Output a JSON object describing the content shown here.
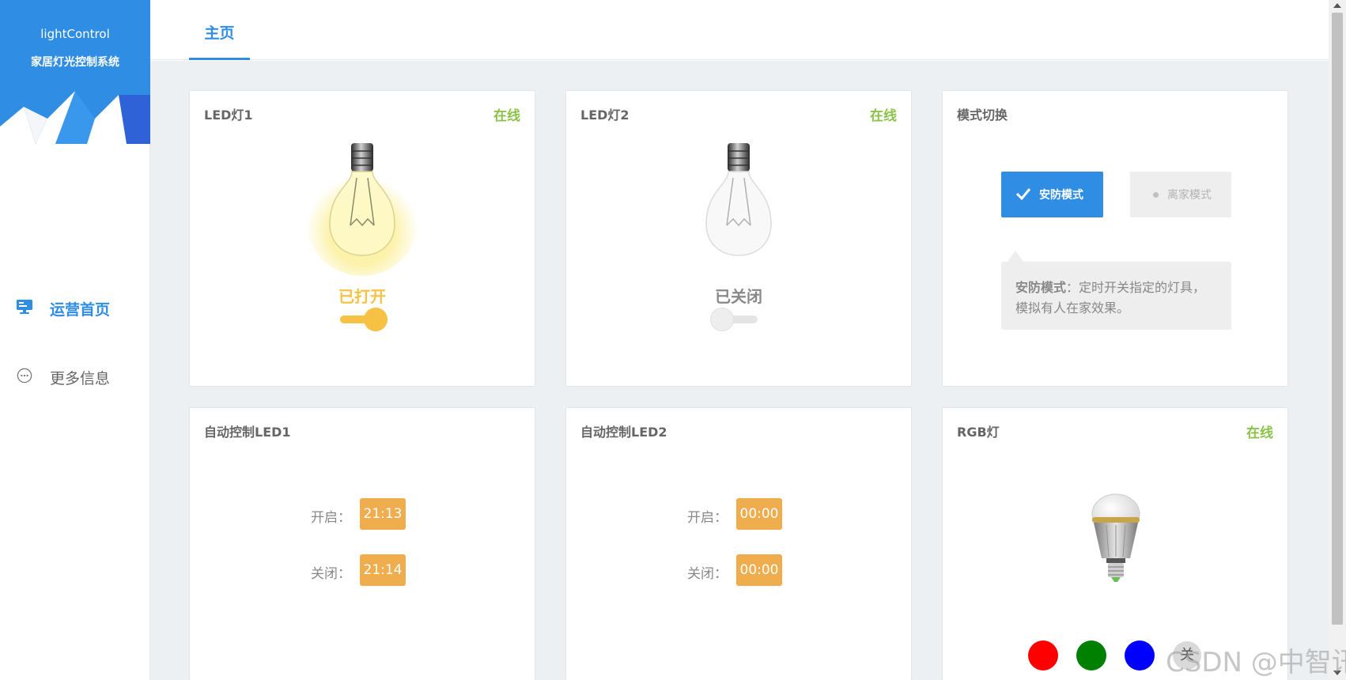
{
  "brand": {
    "name": "lightControl",
    "subtitle": "家居灯光控制系统"
  },
  "sidebar": {
    "items": [
      {
        "label": "运营首页",
        "icon": "monitor-icon",
        "active": true
      },
      {
        "label": "更多信息",
        "icon": "more-icon",
        "active": false
      }
    ]
  },
  "tabs": [
    {
      "label": "主页",
      "active": true
    }
  ],
  "led1": {
    "title": "LED灯1",
    "status": "在线",
    "state": "已打开",
    "on": true
  },
  "led2": {
    "title": "LED灯2",
    "status": "在线",
    "state": "已关闭",
    "on": false
  },
  "mode": {
    "title": "模式切换",
    "options": [
      {
        "label": "安防模式",
        "selected": true
      },
      {
        "label": "离家模式",
        "selected": false
      }
    ],
    "tip_name": "安防模式",
    "tip_text": "：定时开关指定的灯具，模拟有人在家效果。"
  },
  "auto1": {
    "title": "自动控制LED1",
    "open_label": "开启：",
    "open_time": "21:13",
    "close_label": "关闭：",
    "close_time": "21:14"
  },
  "auto2": {
    "title": "自动控制LED2",
    "open_label": "开启：",
    "open_time": "00:00",
    "close_label": "关闭：",
    "close_time": "00:00"
  },
  "rgb": {
    "title": "RGB灯",
    "status": "在线",
    "colors": [
      "#ff0000",
      "#008000",
      "#0000ff"
    ],
    "off_label": "关"
  },
  "watermark": "CSDN @中智讯",
  "colors": {
    "accent": "#2f8de4",
    "online": "#8bc34a",
    "lamp_on": "#f7c244",
    "time_badge": "#f0ad4e"
  }
}
